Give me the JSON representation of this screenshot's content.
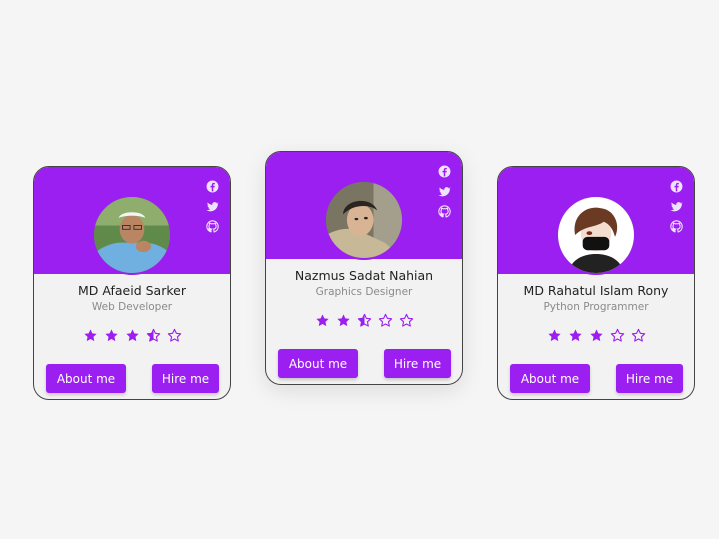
{
  "cards": [
    {
      "name": "MD Afaeid Sarker",
      "role": "Web Developer",
      "about_label": "About me",
      "hire_label": "Hire me",
      "rating": 3.5
    },
    {
      "name": "Nazmus Sadat Nahian",
      "role": "Graphics Designer",
      "about_label": "About me",
      "hire_label": "Hire me",
      "rating": 2.5
    },
    {
      "name": "MD Rahatul Islam Rony",
      "role": "Python Programmer",
      "about_label": "About me",
      "hire_label": "Hire me",
      "rating": 3
    }
  ],
  "socials": [
    "facebook-icon",
    "twitter-icon",
    "github-icon"
  ],
  "colors": {
    "accent": "#9b1ff0",
    "background": "#f5f5f5",
    "card": "#f2f2f2"
  }
}
